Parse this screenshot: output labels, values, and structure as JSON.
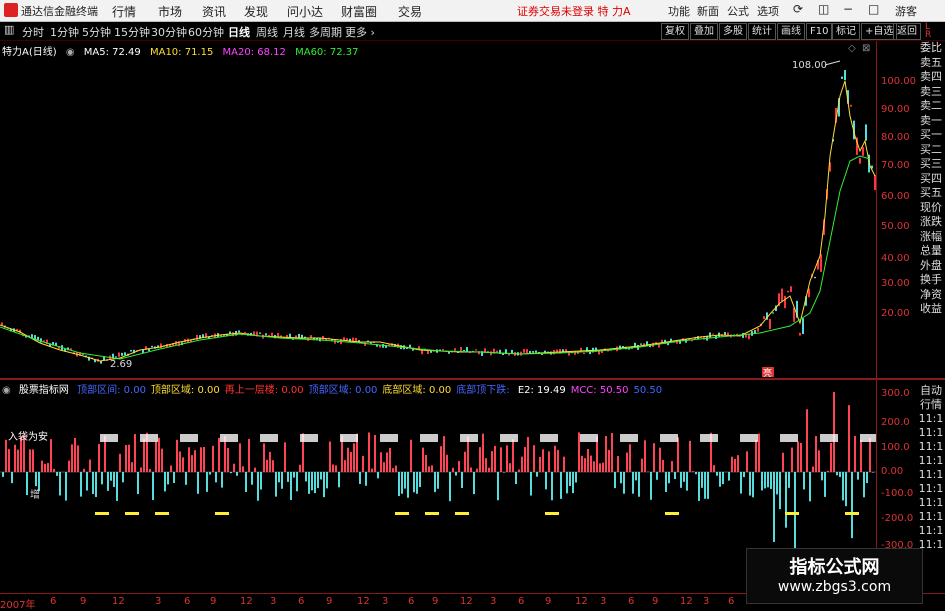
{
  "app": {
    "title": "通达信金融终端"
  },
  "menu": [
    "行情",
    "市场",
    "资讯",
    "发现",
    "问小达",
    "财富圈",
    "交易"
  ],
  "status": {
    "warning": "证券交易未登录",
    "stock": "特 力A"
  },
  "top_right": [
    "功能",
    "新面",
    "公式",
    "选项",
    "游客"
  ],
  "periods": [
    "分时",
    "1分钟",
    "5分钟",
    "15分钟",
    "30分钟",
    "60分钟",
    "日线",
    "周线",
    "月线",
    "多周期",
    "更多"
  ],
  "active_period": "日线",
  "right_buttons": [
    "复权",
    "叠加",
    "多股",
    "统计",
    "画线",
    "F10",
    "标记",
    "+自选",
    "返回"
  ],
  "main_legend": {
    "stock": "特力A(日线)",
    "ma5": "MA5: 72.49",
    "ma10": "MA10: 71.15",
    "ma20": "MA20: 68.12",
    "ma60": "MA60: 72.37"
  },
  "colors": {
    "ma5": "#ffffff",
    "ma10": "#ffdd33",
    "ma20": "#ff44ff",
    "ma60": "#33ee33",
    "axis": "#dd3333",
    "up": "#ff3333",
    "down": "#33dddd"
  },
  "price_axis": [
    "100.00",
    "90.00",
    "80.00",
    "70.00",
    "60.00",
    "50.00",
    "40.00",
    "30.00",
    "20.00"
  ],
  "annotations": {
    "high": "108.00",
    "low": "2.69",
    "marker": "亮"
  },
  "side_labels": [
    "委比",
    "卖五",
    "卖四",
    "卖三",
    "卖二",
    "卖一",
    "买一",
    "买二",
    "买三",
    "买四",
    "买五",
    "现价",
    "涨跌",
    "涨幅",
    "总量",
    "外盘",
    "换手",
    "净资",
    "收益"
  ],
  "side_labels2": [
    "自动",
    "行情",
    "11:1",
    "11:1",
    "11:1",
    "11:1",
    "11:1",
    "11:1",
    "11:1",
    "11:1",
    "11:1",
    "11:1"
  ],
  "indicator": {
    "name": "股票指标网",
    "items": [
      {
        "label": "顶部区间: ",
        "value": "0.00",
        "color": "#4466ff"
      },
      {
        "label": "顶部区域: ",
        "value": "0.00",
        "color": "#ffdd33"
      },
      {
        "label": "再上一层楼: ",
        "value": "0.00",
        "color": "#ff3333"
      },
      {
        "label": "顶部区域: ",
        "value": "0.00",
        "color": "#4466ff"
      },
      {
        "label": "底部区域: ",
        "value": "0.00",
        "color": "#ffdd33"
      },
      {
        "label": "底部顶下跌: ",
        "value": "",
        "color": "#4466ff"
      },
      {
        "label": "E2: ",
        "value": "19.49",
        "color": "#ffffff"
      },
      {
        "label": "MCC: ",
        "value": "50.50",
        "color": "#ff44ff"
      },
      {
        "label": "",
        "value": "50.50",
        "color": "#4466ff"
      }
    ]
  },
  "sub_axis": [
    "300.0",
    "200.0",
    "100.0",
    "0.00",
    "-100.0",
    "-200.0",
    "-300.0"
  ],
  "sub_labels": [
    "入袋为安",
    "增"
  ],
  "x_axis": [
    "2007年",
    "6",
    "9",
    "12",
    "3",
    "6",
    "9",
    "12",
    "3",
    "6",
    "9",
    "12",
    "3",
    "6",
    "9",
    "12",
    "3",
    "6",
    "9",
    "12",
    "3",
    "6",
    "9",
    "12",
    "3",
    "6",
    "9",
    "12",
    "10",
    "12",
    "3",
    "6",
    "9"
  ],
  "watermark": {
    "line1": "指标公式网",
    "line2": "www.zbgs3.com"
  }
}
